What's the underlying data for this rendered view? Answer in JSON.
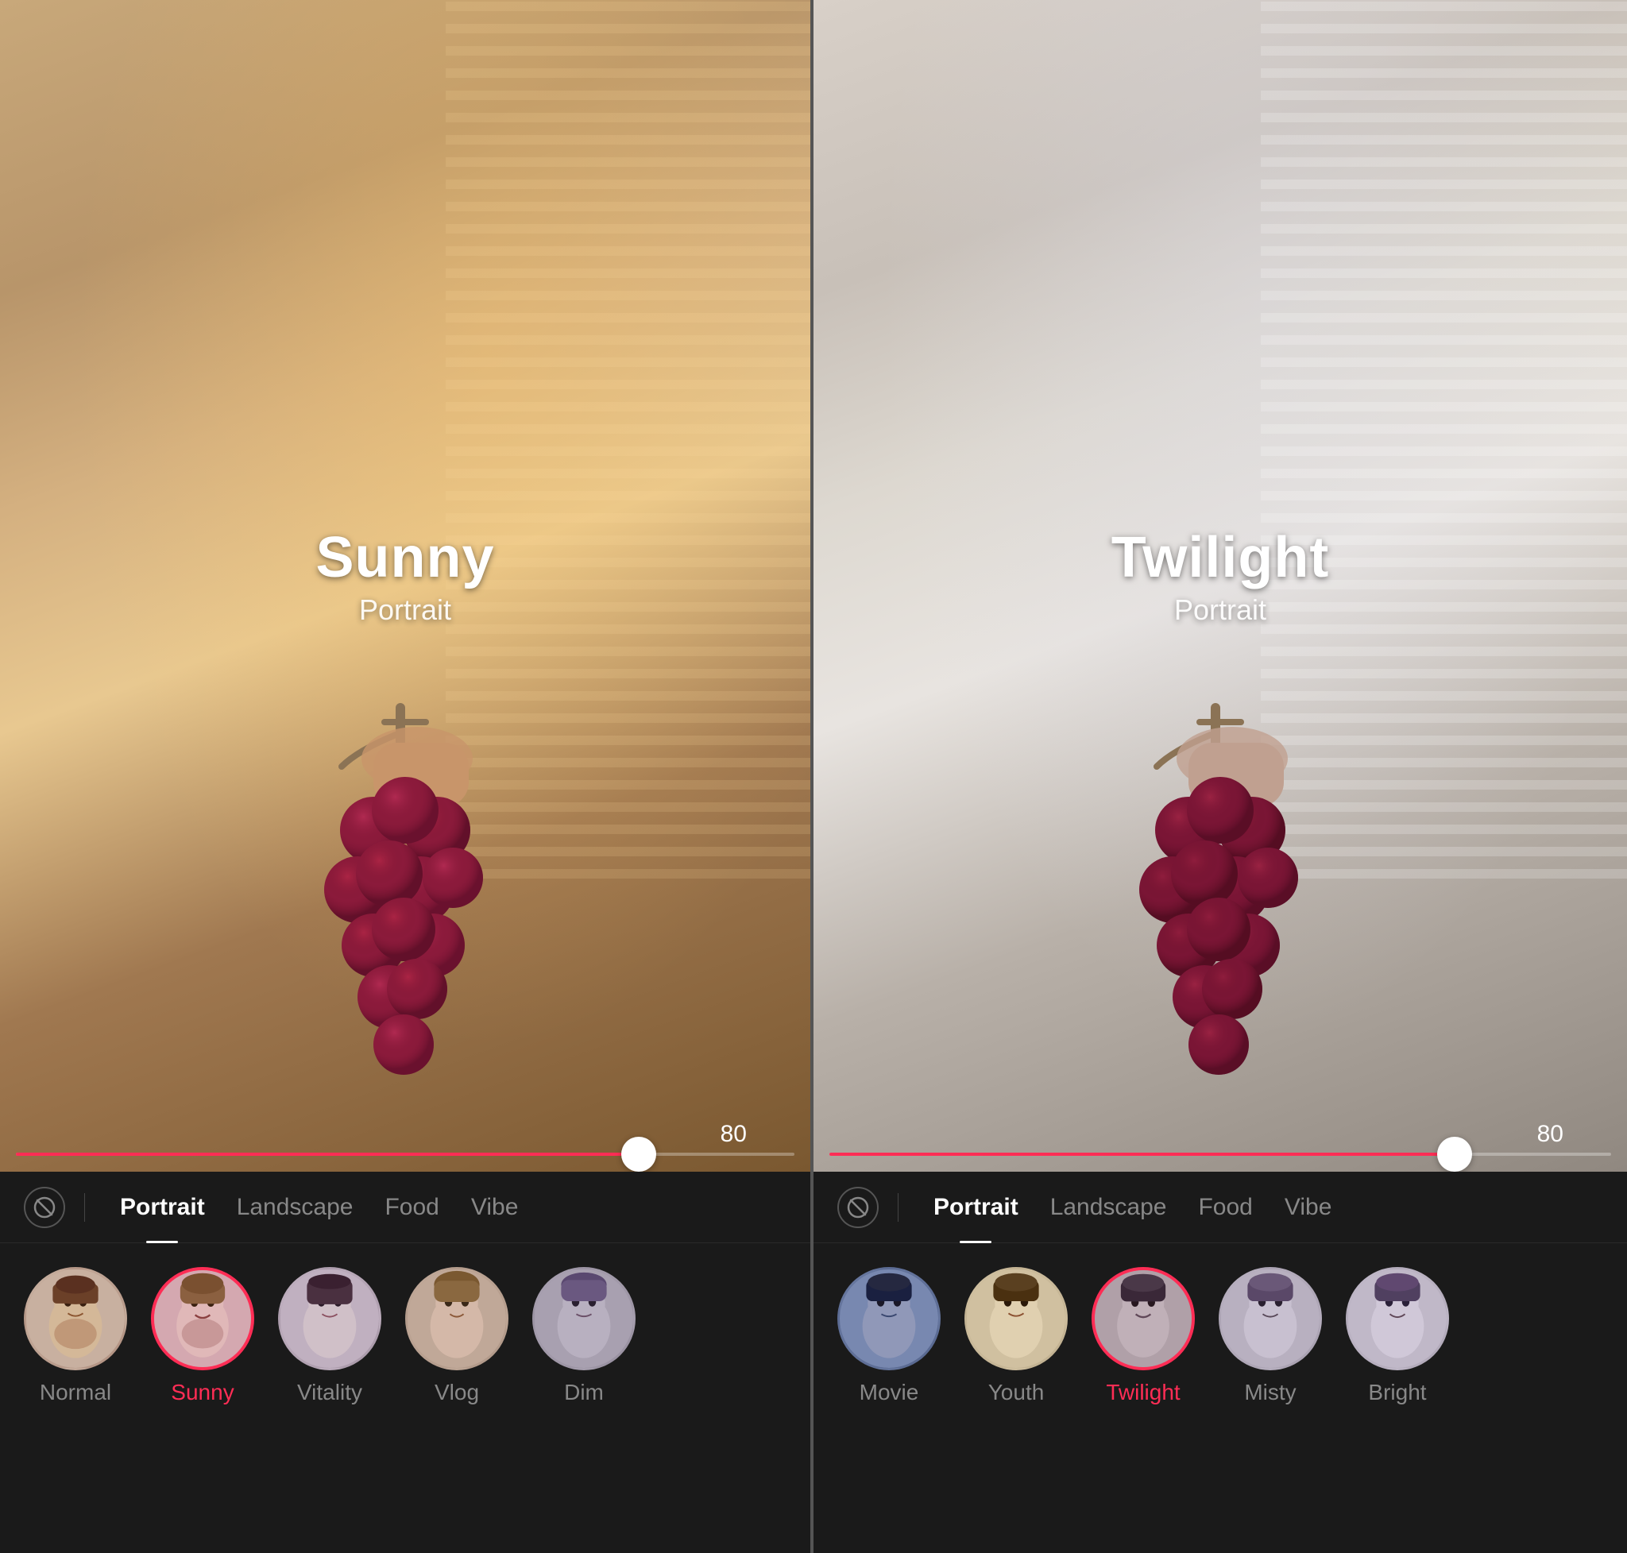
{
  "left_panel": {
    "filter_name": "Sunny",
    "filter_subtitle": "Portrait",
    "slider_value": "80",
    "slider_percent": 80,
    "tab_bar": {
      "no_filter_label": "no filter",
      "tabs": [
        {
          "id": "portrait",
          "label": "Portrait",
          "active": true
        },
        {
          "id": "landscape",
          "label": "Landscape",
          "active": false
        },
        {
          "id": "food",
          "label": "Food",
          "active": false
        },
        {
          "id": "vibe",
          "label": "Vibe",
          "active": false
        }
      ]
    },
    "filters": [
      {
        "id": "normal",
        "label": "Normal",
        "selected": false,
        "bg": "normal"
      },
      {
        "id": "sunny",
        "label": "Sunny",
        "selected": true,
        "bg": "sunny"
      },
      {
        "id": "vitality",
        "label": "Vitality",
        "selected": false,
        "bg": "vitality"
      },
      {
        "id": "vlog",
        "label": "Vlog",
        "selected": false,
        "bg": "vlog"
      },
      {
        "id": "dim",
        "label": "Dim",
        "selected": false,
        "bg": "dim"
      }
    ]
  },
  "right_panel": {
    "filter_name": "Twilight",
    "filter_subtitle": "Portrait",
    "slider_value": "80",
    "slider_percent": 80,
    "tab_bar": {
      "no_filter_label": "no filter",
      "tabs": [
        {
          "id": "portrait",
          "label": "Portrait",
          "active": true
        },
        {
          "id": "landscape",
          "label": "Landscape",
          "active": false
        },
        {
          "id": "food",
          "label": "Food",
          "active": false
        },
        {
          "id": "vibe",
          "label": "Vibe",
          "active": false
        }
      ]
    },
    "filters": [
      {
        "id": "movie",
        "label": "Movie",
        "selected": false,
        "bg": "movie"
      },
      {
        "id": "youth",
        "label": "Youth",
        "selected": false,
        "bg": "youth"
      },
      {
        "id": "twilight",
        "label": "Twilight",
        "selected": true,
        "bg": "twilight"
      },
      {
        "id": "misty",
        "label": "Misty",
        "selected": false,
        "bg": "misty"
      },
      {
        "id": "bright",
        "label": "Bright",
        "selected": false,
        "bg": "bright"
      }
    ]
  },
  "accent_color": "#ff2d55"
}
